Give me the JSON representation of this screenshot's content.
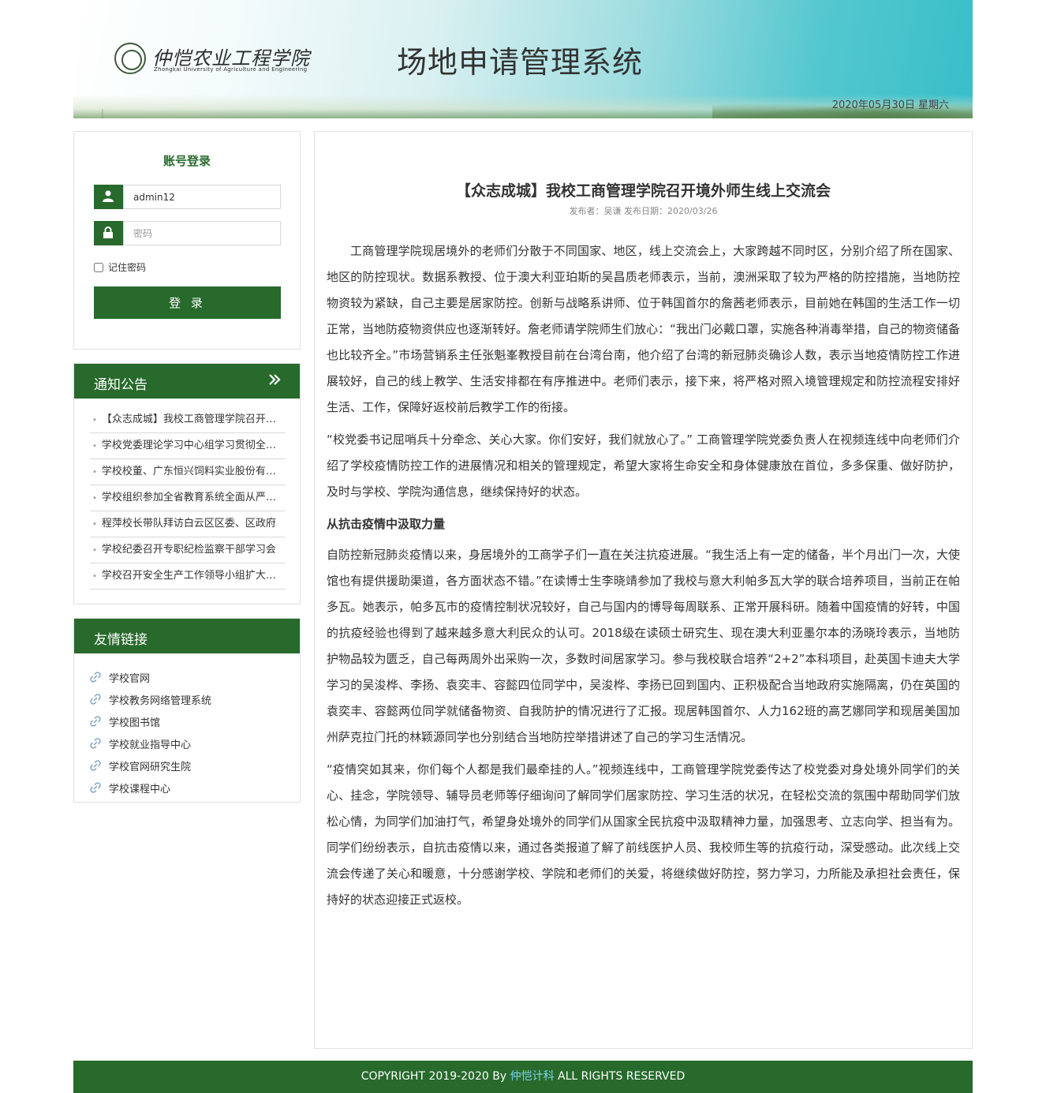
{
  "header": {
    "logo_cn": "仲恺农业工程学院",
    "logo_en": "Zhongkai University of Agriculture and Engineering",
    "system_title": "场地申请管理系统",
    "date": "2020年05月30日 星期六"
  },
  "login": {
    "title": "账号登录",
    "username_value": "admin12",
    "password_placeholder": "密码",
    "remember_label": "记住密码",
    "submit_label": "登 录"
  },
  "notice": {
    "title": "通知公告",
    "more_icon": "double-chevron-right-icon",
    "items": [
      "【众志成城】我校工商管理学院召开境外师生线上交流会",
      "学校党委理论学习中心组学习贯彻全国两会精神",
      "学校校董、广东恒兴饲料实业股份有限公司来校交流",
      "学校组织参加全省教育系统全面从严治党工作会议",
      "程萍校长带队拜访白云区区委、区政府",
      "学校纪委召开专职纪检监察干部学习会",
      "学校召开安全生产工作领导小组扩大会议"
    ]
  },
  "links": {
    "title": "友情链接",
    "items": [
      "学校官网",
      "学校教务网络管理系统",
      "学校图书馆",
      "学校就业指导中心",
      "学校官网研究生院",
      "学校课程中心"
    ]
  },
  "article": {
    "title": "【众志成城】我校工商管理学院召开境外师生线上交流会",
    "meta": "发布者：吴谦 发布日期：2020/03/26",
    "p1": "工商管理学院现居境外的老师们分散于不同国家、地区，线上交流会上，大家跨越不同时区，分别介绍了所在国家、地区的防控现状。数据系教授、位于澳大利亚珀斯的吴昌质老师表示，当前，澳洲采取了较为严格的防控措施，当地防控物资较为紧缺，自己主要是居家防控。创新与战略系讲师、位于韩国首尔的詹茜老师表示，目前她在韩国的生活工作一切正常，当地防疫物资供应也逐渐转好。詹老师请学院师生们放心：“我出门必戴口罩，实施各种消毒举措，自己的物资储备也比较齐全。”市场营销系主任张魁峯教授目前在台湾台南，他介绍了台湾的新冠肺炎确诊人数，表示当地疫情防控工作进展较好，自己的线上教学、生活安排都在有序推进中。老师们表示，接下来，将严格对照入境管理规定和防控流程安排好生活、工作，保障好返校前后教学工作的衔接。",
    "p2": "“校党委书记屈哨兵十分牵念、关心大家。你们安好，我们就放心了。” 工商管理学院党委负责人在视频连线中向老师们介绍了学校疫情防控工作的进展情况和相关的管理规定，希望大家将生命安全和身体健康放在首位，多多保重、做好防护，及时与学校、学院沟通信息，继续保持好的状态。",
    "subheading": "从抗击疫情中汲取力量",
    "p3": "自防控新冠肺炎疫情以来，身居境外的工商学子们一直在关注抗疫进展。“我生活上有一定的储备，半个月出门一次，大使馆也有提供援助渠道，各方面状态不错。”在读博士生李晓靖参加了我校与意大利帕多瓦大学的联合培养项目，当前正在帕多瓦。她表示，帕多瓦市的疫情控制状况较好，自己与国内的博导每周联系、正常开展科研。随着中国疫情的好转，中国的抗疫经验也得到了越来越多意大利民众的认可。2018级在读硕士研究生、现在澳大利亚墨尔本的汤晓玲表示，当地防护物品较为匮乏，自己每两周外出采购一次，多数时间居家学习。参与我校联合培养“2+2”本科项目，赴英国卡迪夫大学学习的吴浚桦、李扬、袁奕丰、容懿四位同学中，吴浚桦、李扬已回到国内、正积极配合当地政府实施隔离，仍在英国的袁奕丰、容懿两位同学就储备物资、自我防护的情况进行了汇报。现居韩国首尔、人力162班的高艺娜同学和现居美国加州萨克拉门托的林颖源同学也分别结合当地防控举措讲述了自己的学习生活情况。",
    "p4": "“疫情突如其来，你们每个人都是我们最牵挂的人。”视频连线中，工商管理学院党委传达了校党委对身处境外同学们的关心、挂念，学院领导、辅导员老师等仔细询问了解同学们居家防控、学习生活的状况，在轻松交流的氛围中帮助同学们放松心情，为同学们加油打气，希望身处境外的同学们从国家全民抗疫中汲取精神力量，加强思考、立志向学、担当有为。同学们纷纷表示，自抗击疫情以来，通过各类报道了解了前线医护人员、我校师生等的抗疫行动，深受感动。此次线上交流会传递了关心和暖意，十分感谢学校、学院和老师们的关爱，将继续做好防控，努力学习，力所能及承担社会责任，保持好的状态迎接正式返校。"
  },
  "footer": {
    "prefix": "COPYRIGHT 2019-2020 By ",
    "brand": "仲恺计科",
    "suffix": " ALL RIGHTS RESERVED"
  },
  "colors": {
    "primary_green": "#276a2b",
    "footer_link": "#7fd3f0"
  }
}
